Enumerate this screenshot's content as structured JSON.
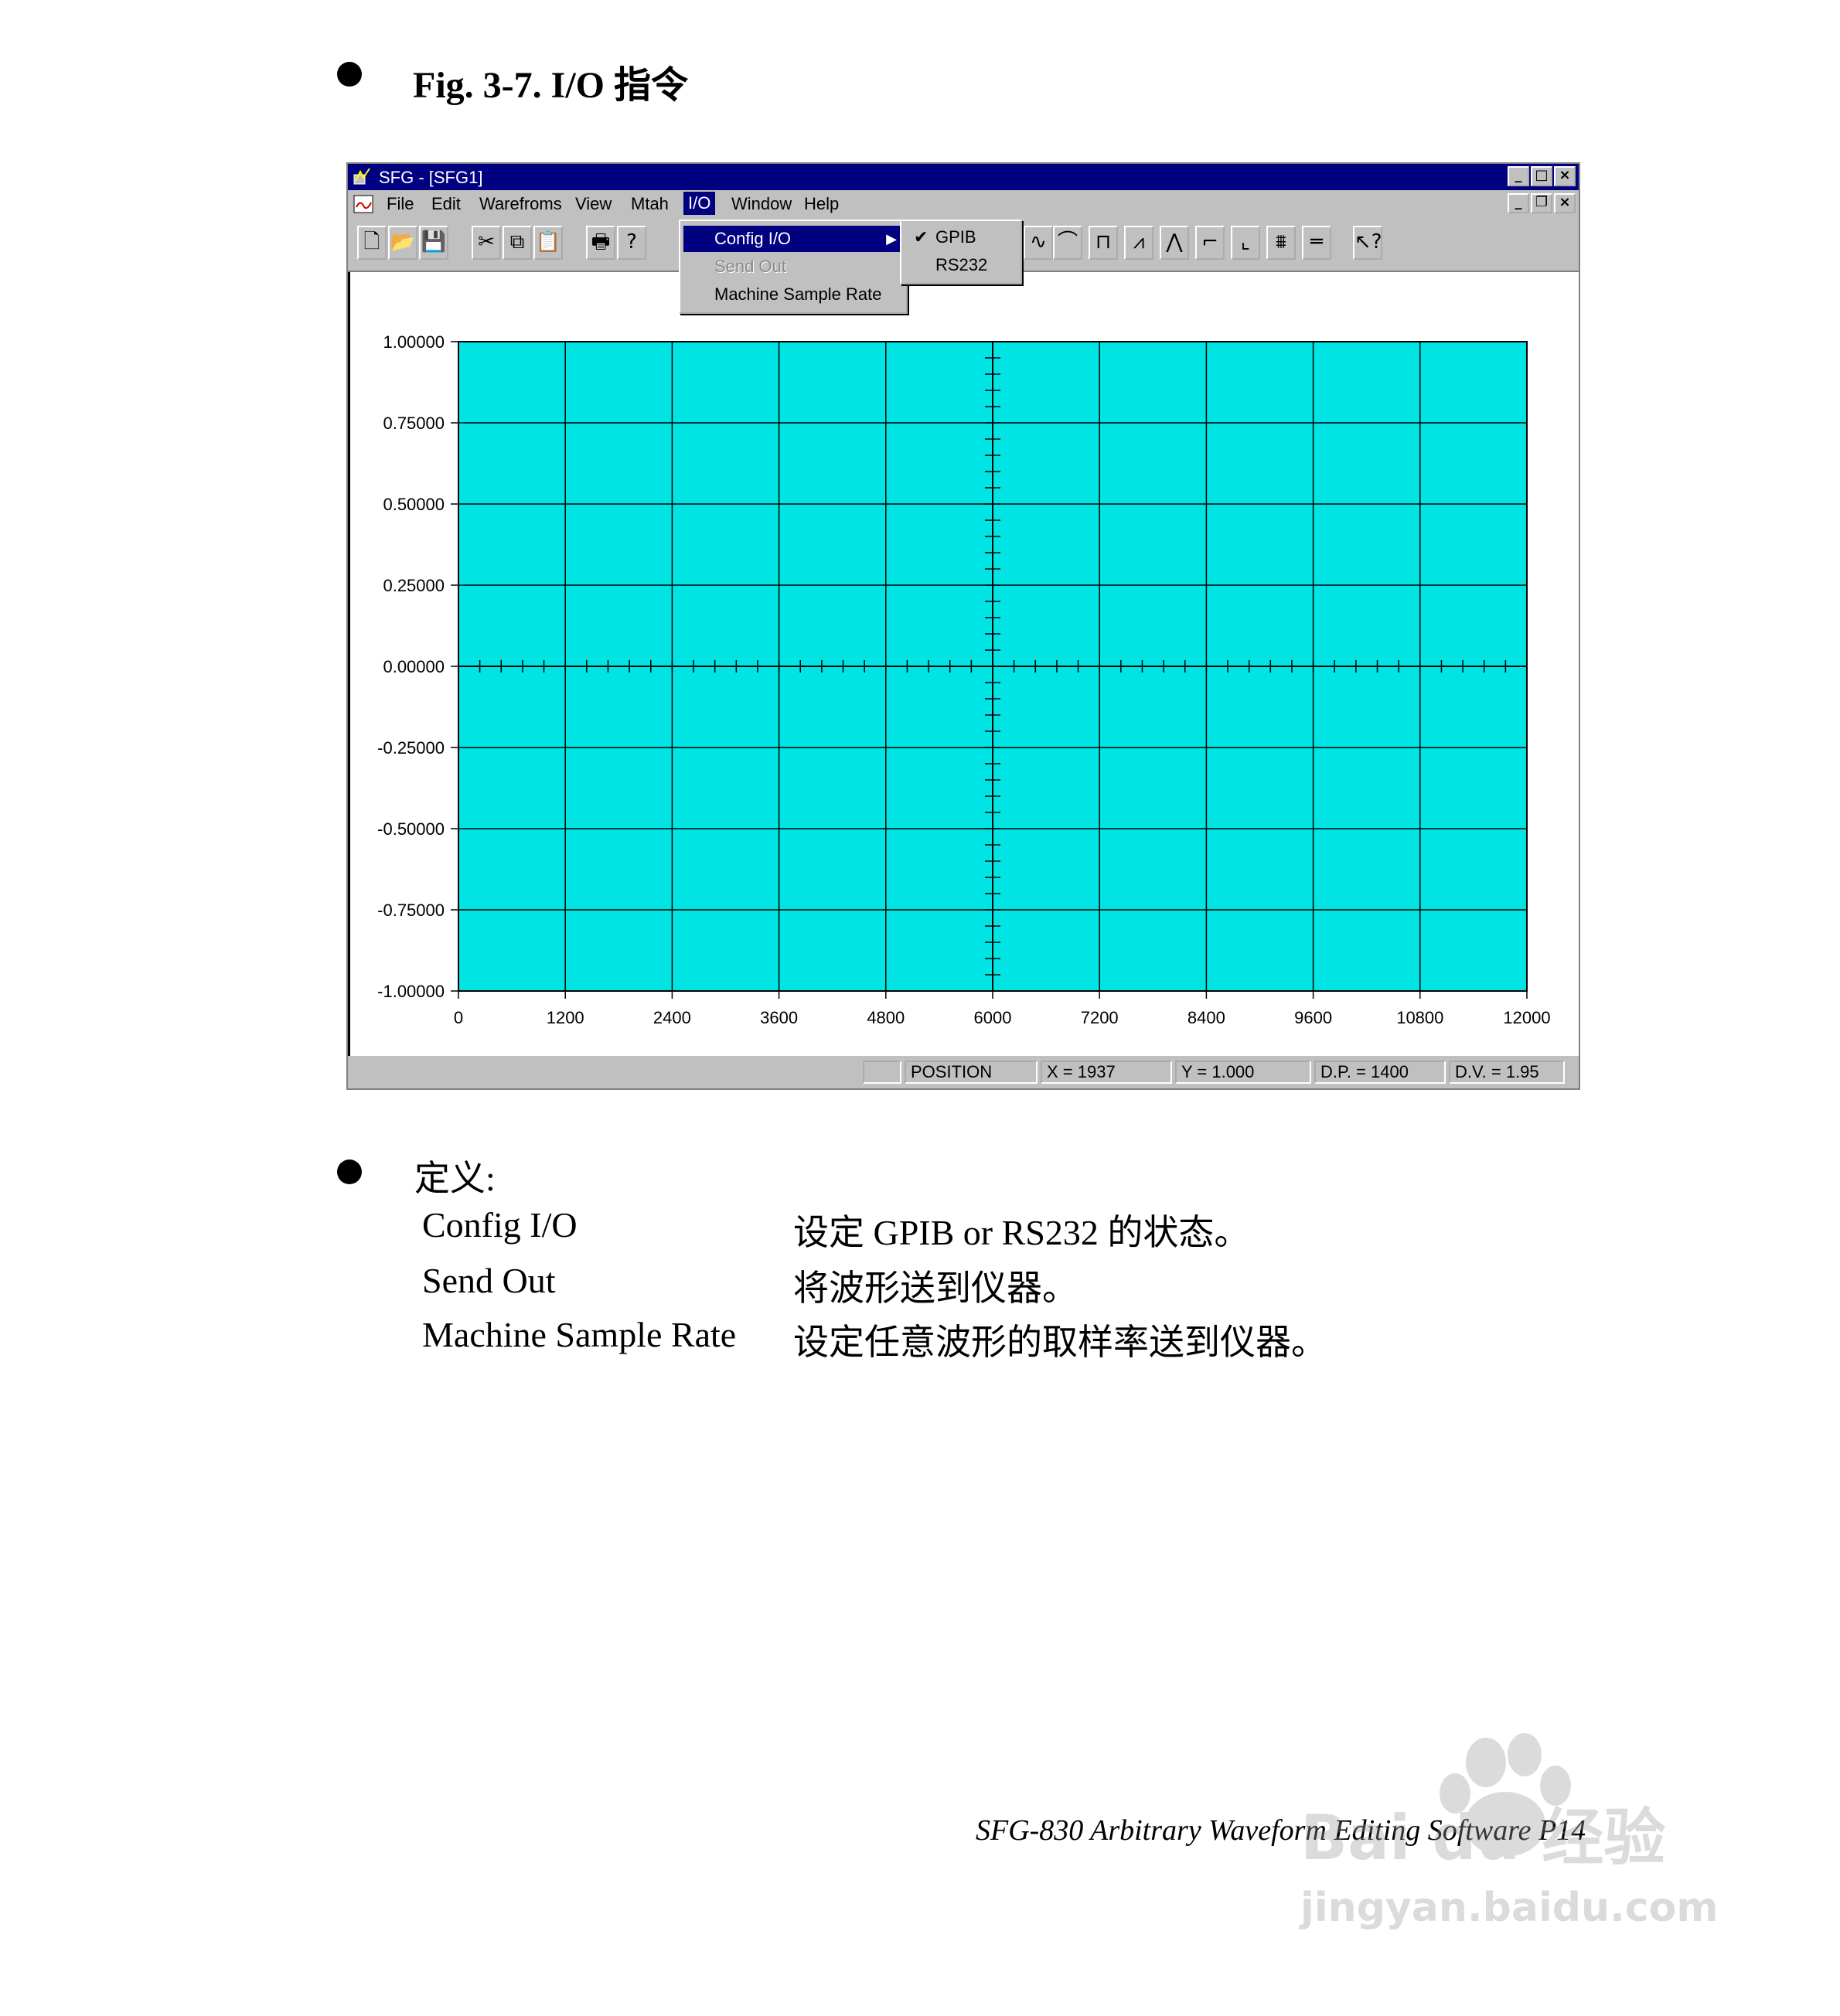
{
  "page": {
    "heading": "Fig. 3-7. I/O  指令",
    "definitions_title": "定义:",
    "definitions": [
      {
        "term": "Config I/O",
        "desc": "设定 GPIB or RS232 的状态。"
      },
      {
        "term": "Send Out",
        "desc": "将波形送到仪器。"
      },
      {
        "term": "Machine Sample Rate",
        "desc": "设定任意波形的取样率送到仪器。"
      }
    ],
    "footer": "SFG-830 Arbitrary Waveform Editing Software    P14",
    "watermark": {
      "logo": "Bai du 经验",
      "url": "jingyan.baidu.com"
    }
  },
  "window": {
    "title": "SFG - [SFG1]",
    "buttons": [
      "minimize-icon",
      "maximize-icon",
      "close-icon"
    ],
    "menu": [
      "File",
      "Edit",
      "Warefroms",
      "View",
      "Mtah",
      "I/O",
      "Window",
      "Help"
    ],
    "io_menu": {
      "items": [
        {
          "label": "Config I/O",
          "state": "selected",
          "submenu": true
        },
        {
          "label": "Send Out",
          "state": "disabled"
        },
        {
          "label": "Machine Sample Rate",
          "state": "normal"
        }
      ]
    },
    "config_submenu": {
      "items": [
        {
          "label": "GPIB",
          "checked": true
        },
        {
          "label": "RS232",
          "checked": false
        }
      ]
    },
    "toolbar_icons": [
      "new-icon",
      "open-icon",
      "save-icon",
      "cut-icon",
      "copy-icon",
      "paste-icon",
      "print-icon",
      "help-icon",
      "sine-icon",
      "half-sine-icon",
      "square-icon",
      "sawtooth-icon",
      "pulse-icon",
      "exp-rise-icon",
      "exp-fall-icon",
      "noise-icon",
      "dc-icon",
      "context-help-icon"
    ],
    "status": {
      "mode": "POSITION",
      "x": "X = 1937",
      "y": "Y = 1.000",
      "dp": "D.P. = 1400",
      "dv": "D.V. = 1.95"
    }
  },
  "chart_data": {
    "type": "line",
    "title": "",
    "xlabel": "",
    "ylabel": "",
    "xlim": [
      0,
      12000
    ],
    "ylim": [
      -1.0,
      1.0
    ],
    "x_ticks": [
      "0",
      "1200",
      "2400",
      "3600",
      "4800",
      "6000",
      "7200",
      "8400",
      "9600",
      "10800",
      "12000"
    ],
    "y_ticks": [
      "1.00000",
      "0.75000",
      "0.50000",
      "0.25000",
      "0.00000",
      "-0.25000",
      "-0.50000",
      "-0.75000",
      "-1.00000"
    ],
    "plot_background": "#00e4e4",
    "grid": true,
    "series": []
  }
}
